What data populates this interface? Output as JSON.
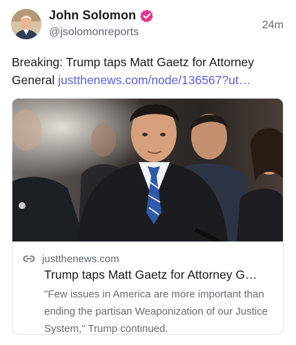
{
  "author": {
    "display_name": "John Solomon",
    "handle": "@jsolomonreports",
    "verified_badge_color": "#e2368c",
    "avatar_icon": "profile-photo"
  },
  "post": {
    "timestamp": "24m",
    "text": "Breaking: Trump taps Matt Gaetz for Attorney General ",
    "link_text": "justthenews.com/node/136567?ut…",
    "link_color": "#5b5fe0"
  },
  "card": {
    "image_icon": "news-photo",
    "domain_icon": "link-icon",
    "domain": "justthenews.com",
    "title": "Trump taps Matt Gaetz for Attorney G…",
    "description": "\"Few issues in America are more important than ending the partisan Weaponization of our Justice System,\" Trump continued."
  }
}
